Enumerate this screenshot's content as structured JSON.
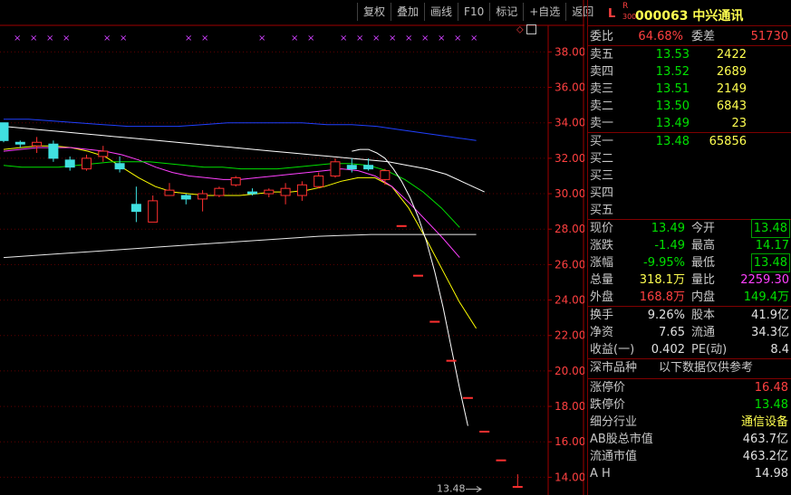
{
  "toolbar": {
    "buttons": [
      "复权",
      "叠加",
      "画线",
      "F10",
      "标记",
      "+自选",
      "返回"
    ]
  },
  "chart": {
    "yaxis_ticks": [
      "38.00",
      "36.00",
      "34.00",
      "32.00",
      "30.00",
      "28.00",
      "26.00",
      "24.00",
      "22.00",
      "20.00",
      "18.00",
      "16.00",
      "14.00"
    ],
    "last_price_label": "13.48"
  },
  "chart_data": {
    "type": "candlestick",
    "ylim": [
      13,
      39.5
    ],
    "yticks": [
      38,
      36,
      34,
      32,
      30,
      28,
      26,
      24,
      22,
      20,
      18,
      16,
      14
    ],
    "candles": [
      {
        "o": 34.0,
        "h": 34.0,
        "l": 32.9,
        "c": 33.0
      },
      {
        "o": 32.9,
        "h": 33.0,
        "l": 32.6,
        "c": 32.8
      },
      {
        "o": 32.7,
        "h": 33.2,
        "l": 32.3,
        "c": 32.9
      },
      {
        "o": 32.8,
        "h": 33.0,
        "l": 31.8,
        "c": 32.0
      },
      {
        "o": 31.9,
        "h": 32.1,
        "l": 31.3,
        "c": 31.5
      },
      {
        "o": 31.4,
        "h": 32.2,
        "l": 31.3,
        "c": 32.0
      },
      {
        "o": 32.1,
        "h": 32.7,
        "l": 31.8,
        "c": 32.4
      },
      {
        "o": 31.7,
        "h": 32.1,
        "l": 31.2,
        "c": 31.4
      },
      {
        "o": 29.4,
        "h": 30.4,
        "l": 28.4,
        "c": 29.0
      },
      {
        "o": 28.4,
        "h": 29.9,
        "l": 28.4,
        "c": 29.6
      },
      {
        "o": 29.9,
        "h": 30.6,
        "l": 29.9,
        "c": 30.2
      },
      {
        "o": 29.9,
        "h": 30.0,
        "l": 29.4,
        "c": 29.7
      },
      {
        "o": 29.7,
        "h": 30.2,
        "l": 29.0,
        "c": 30.0
      },
      {
        "o": 29.9,
        "h": 30.4,
        "l": 29.8,
        "c": 30.3
      },
      {
        "o": 30.5,
        "h": 31.0,
        "l": 30.4,
        "c": 30.9
      },
      {
        "o": 30.1,
        "h": 30.3,
        "l": 29.9,
        "c": 30.0
      },
      {
        "o": 30.0,
        "h": 30.3,
        "l": 29.8,
        "c": 30.2
      },
      {
        "o": 29.9,
        "h": 30.6,
        "l": 29.4,
        "c": 30.3
      },
      {
        "o": 29.9,
        "h": 30.7,
        "l": 29.6,
        "c": 30.5
      },
      {
        "o": 30.4,
        "h": 31.2,
        "l": 30.3,
        "c": 31.0
      },
      {
        "o": 31.0,
        "h": 32.0,
        "l": 30.9,
        "c": 31.8
      },
      {
        "o": 31.6,
        "h": 32.0,
        "l": 31.2,
        "c": 31.4
      },
      {
        "o": 31.6,
        "h": 32.0,
        "l": 31.3,
        "c": 31.4
      },
      {
        "o": 30.8,
        "h": 31.4,
        "l": 30.5,
        "c": 31.3
      },
      {
        "o": 28.2,
        "h": 28.2,
        "l": 28.2,
        "c": 28.2
      },
      {
        "o": 25.4,
        "h": 25.4,
        "l": 25.4,
        "c": 25.4
      },
      {
        "o": 22.8,
        "h": 22.8,
        "l": 22.8,
        "c": 22.8
      },
      {
        "o": 20.6,
        "h": 20.6,
        "l": 20.6,
        "c": 20.6
      },
      {
        "o": 18.5,
        "h": 18.5,
        "l": 18.5,
        "c": 18.5
      },
      {
        "o": 16.6,
        "h": 16.6,
        "l": 16.6,
        "c": 16.6
      },
      {
        "o": 14.98,
        "h": 14.98,
        "l": 14.98,
        "c": 14.98
      },
      {
        "o": 13.48,
        "h": 14.17,
        "l": 13.48,
        "c": 13.48
      }
    ],
    "series": [
      {
        "color": "#ffffff",
        "values": [
          33.8,
          33.7,
          33.6,
          33.5,
          33.4,
          33.3,
          33.2,
          33.1,
          33.0,
          32.9,
          32.8,
          32.7,
          32.6,
          32.5,
          32.4,
          32.3,
          32.2,
          32.1,
          32.0,
          31.9,
          31.8,
          31.6,
          31.4,
          31.1,
          30.6,
          30.1
        ]
      },
      {
        "color": "#ffff00",
        "values": [
          32.5,
          32.6,
          32.7,
          32.7,
          32.6,
          32.4,
          32.1,
          31.5,
          30.9,
          30.4,
          30.1,
          30.0,
          29.9,
          29.9,
          29.9,
          30.0,
          30.1,
          30.1,
          30.2,
          30.4,
          30.7,
          30.9,
          30.9,
          30.4,
          29.2,
          27.5,
          25.7,
          23.9,
          22.4
        ]
      },
      {
        "color": "#ff40ff",
        "values": [
          32.4,
          32.5,
          32.6,
          32.6,
          32.6,
          32.5,
          32.4,
          32.2,
          31.9,
          31.5,
          31.2,
          31.0,
          30.9,
          30.8,
          30.8,
          30.9,
          31.0,
          31.1,
          31.2,
          31.3,
          31.4,
          31.3,
          31.0,
          30.4,
          29.5,
          28.5,
          27.5,
          26.4
        ]
      },
      {
        "color": "#00e000",
        "values": [
          31.6,
          31.5,
          31.5,
          31.5,
          31.6,
          31.7,
          31.8,
          31.8,
          31.8,
          31.7,
          31.6,
          31.5,
          31.5,
          31.4,
          31.4,
          31.4,
          31.5,
          31.6,
          31.7,
          31.7,
          31.6,
          31.3,
          30.8,
          30.1,
          29.2,
          28.1
        ]
      },
      {
        "color": "#2040ff",
        "values": [
          34.2,
          34.2,
          34.1,
          34.0,
          33.9,
          33.8,
          33.8,
          33.8,
          33.9,
          34.0,
          34.0,
          34.0,
          34.0,
          33.9,
          33.9,
          33.8,
          33.6,
          33.4,
          33.2,
          33.0
        ]
      },
      {
        "color": "#ffffff",
        "values": [
          32.4,
          32.5,
          32.5,
          32.3,
          32.0,
          31.4,
          30.7,
          29.8,
          28.7,
          27.3,
          25.6,
          23.6,
          21.3,
          19.0,
          16.9
        ]
      },
      {
        "color": "#e8e8e8",
        "values": [
          26.4,
          26.6,
          26.8,
          27.0,
          27.2,
          27.4,
          27.6,
          27.7,
          27.7,
          27.7
        ]
      }
    ],
    "markers_x": [
      1,
      3,
      5,
      7,
      12,
      14,
      22,
      24,
      31,
      35,
      37,
      41,
      43,
      45,
      47,
      49,
      51,
      53,
      55,
      57
    ]
  },
  "panel": {
    "header": {
      "L": "L",
      "R": "R",
      "sub": "300",
      "code": "000063",
      "name": "中兴通讯"
    },
    "weibi": {
      "label1": "委比",
      "value1": "64.68%",
      "label2": "委差",
      "value2": "51730"
    },
    "sells": [
      {
        "label": "卖五",
        "price": "13.53",
        "vol": "2422"
      },
      {
        "label": "卖四",
        "price": "13.52",
        "vol": "2689"
      },
      {
        "label": "卖三",
        "price": "13.51",
        "vol": "2149"
      },
      {
        "label": "卖二",
        "price": "13.50",
        "vol": "6843"
      },
      {
        "label": "卖一",
        "price": "13.49",
        "vol": "23"
      }
    ],
    "buys": [
      {
        "label": "买一",
        "price": "13.48",
        "vol": "65856"
      },
      {
        "label": "买二",
        "price": "",
        "vol": ""
      },
      {
        "label": "买三",
        "price": "",
        "vol": ""
      },
      {
        "label": "买四",
        "price": "",
        "vol": ""
      },
      {
        "label": "买五",
        "price": "",
        "vol": ""
      }
    ],
    "quote": [
      {
        "l1": "现价",
        "v1": "13.49",
        "c1": "green",
        "l2": "今开",
        "v2": "13.48",
        "c2": "green",
        "box2": true
      },
      {
        "l1": "涨跌",
        "v1": "-1.49",
        "c1": "green",
        "l2": "最高",
        "v2": "14.17",
        "c2": "green"
      },
      {
        "l1": "涨幅",
        "v1": "-9.95%",
        "c1": "green",
        "l2": "最低",
        "v2": "13.48",
        "c2": "green",
        "box2": true
      },
      {
        "l1": "总量",
        "v1": "318.1万",
        "c1": "yellow",
        "l2": "量比",
        "v2": "2259.30",
        "c2": "mag"
      },
      {
        "l1": "外盘",
        "v1": "168.8万",
        "c1": "red",
        "l2": "内盘",
        "v2": "149.4万",
        "c2": "green"
      }
    ],
    "stats": [
      {
        "l1": "换手",
        "v1": "9.26%",
        "l2": "股本",
        "v2": "41.9亿"
      },
      {
        "l1": "净资",
        "v1": "7.65",
        "l2": "流通",
        "v2": "34.3亿"
      },
      {
        "l1": "收益(一)",
        "v1": "0.402",
        "l2": "PE(动)",
        "v2": "8.4"
      }
    ],
    "notice": {
      "left": "深市品种",
      "right": "以下数据仅供参考"
    },
    "limits": [
      {
        "label": "涨停价",
        "value": "16.48",
        "color": "red"
      },
      {
        "label": "跌停价",
        "value": "13.48",
        "color": "green"
      },
      {
        "label": "细分行业",
        "value": "通信设备",
        "color": "yellow"
      },
      {
        "label": "AB股总市值",
        "value": "463.7亿",
        "color": "white"
      },
      {
        "label": "流通市值",
        "value": "463.2亿",
        "color": "white"
      },
      {
        "label": "A H",
        "value": "14.98",
        "color": "white"
      }
    ]
  }
}
